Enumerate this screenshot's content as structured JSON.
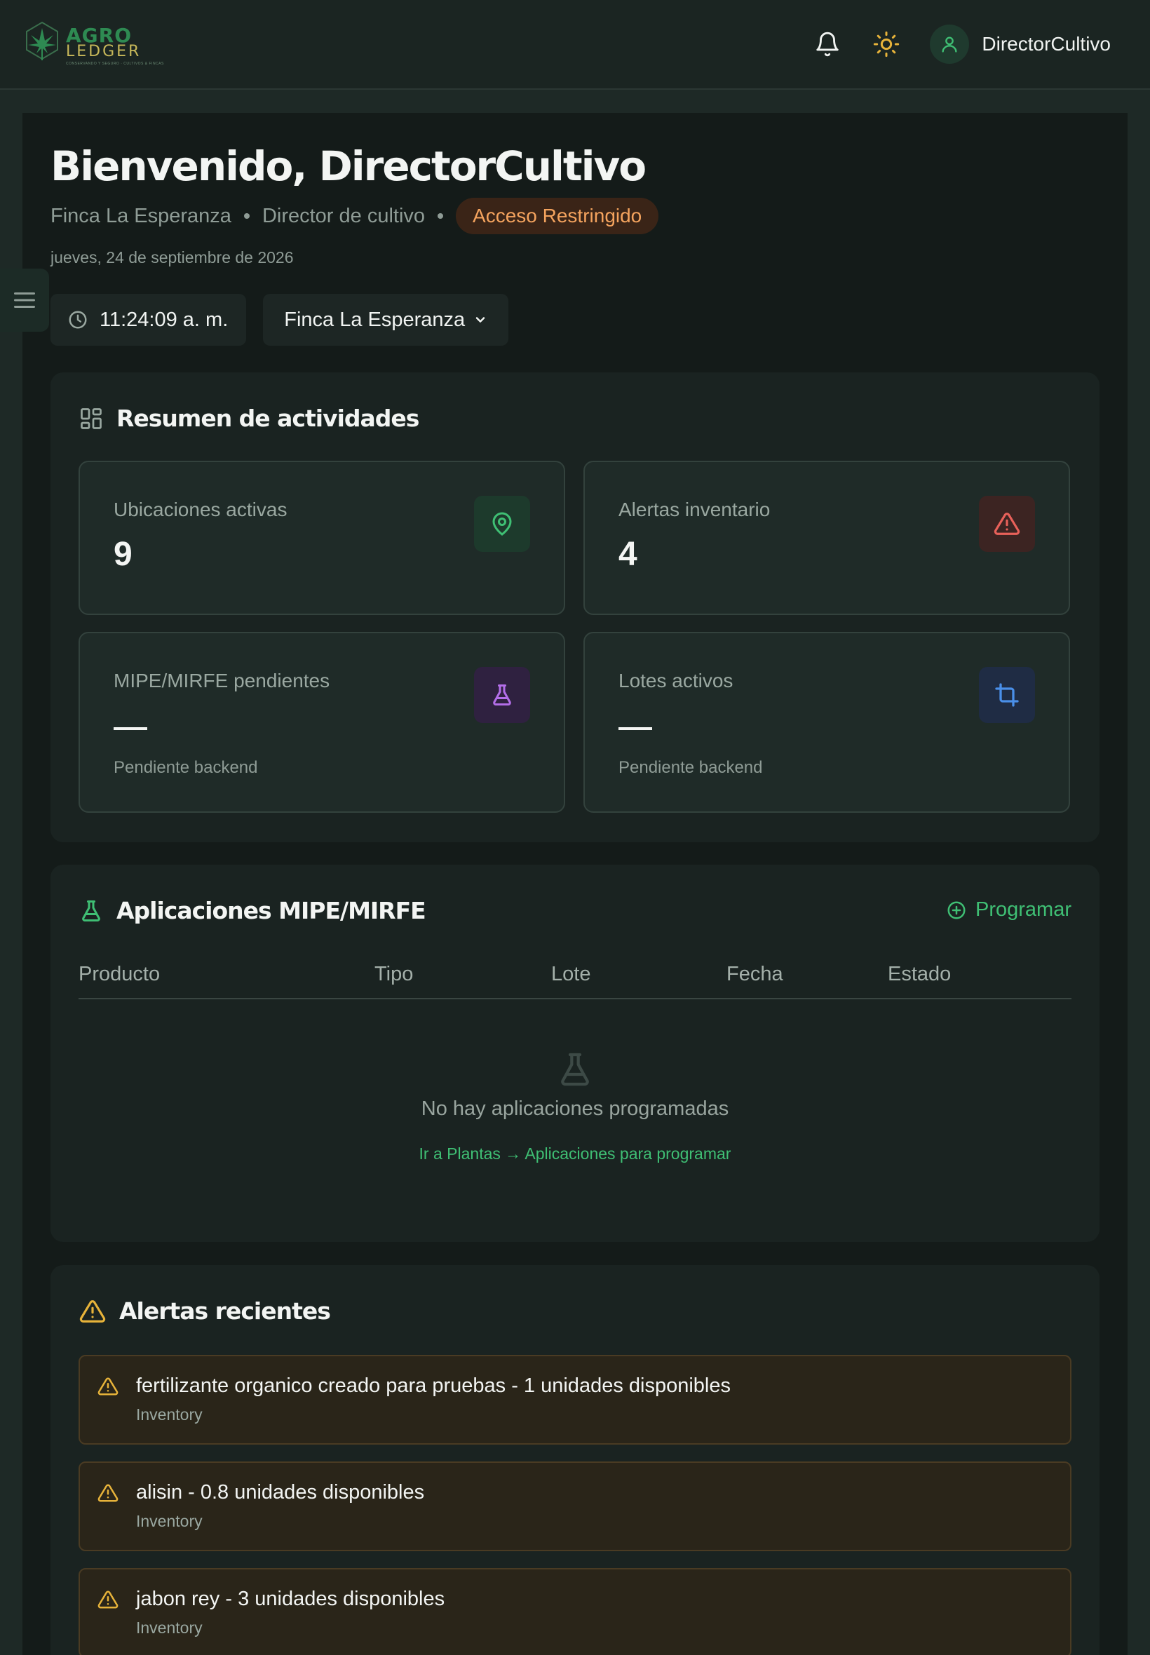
{
  "header": {
    "logo": {
      "primary": "AGRO",
      "secondary": "LEDGER",
      "tagline": "CONSERVANDO Y SEGURO · CULTIVOS & FINCAS"
    },
    "notifications_icon": "bell-icon",
    "theme_icon": "sun-icon",
    "user": {
      "name": "DirectorCultivo",
      "icon": "user-icon"
    }
  },
  "welcome": {
    "title": "Bienvenido, DirectorCultivo",
    "farm": "Finca La Esperanza",
    "role": "Director de cultivo",
    "access_badge": "Acceso Restringido",
    "date": "jueves, 24 de septiembre de 2026"
  },
  "controls": {
    "time": "11:24:09 a. m.",
    "farm_selected": "Finca La Esperanza"
  },
  "summary": {
    "title": "Resumen de actividades",
    "stats": [
      {
        "label": "Ubicaciones activas",
        "value": "9",
        "icon": "map-pin-icon",
        "color": "#3fbf74"
      },
      {
        "label": "Alertas inventario",
        "value": "4",
        "icon": "alert-triangle-icon",
        "color": "#e8615a"
      },
      {
        "label": "MIPE/MIRFE pendientes",
        "value": "—",
        "note": "Pendiente backend",
        "icon": "flask-icon",
        "color": "#b36ee8"
      },
      {
        "label": "Lotes activos",
        "value": "—",
        "note": "Pendiente backend",
        "icon": "crop-icon",
        "color": "#4a8fe8"
      }
    ]
  },
  "applications": {
    "title": "Aplicaciones MIPE/MIRFE",
    "action": "Programar",
    "columns": [
      "Producto",
      "Tipo",
      "Lote",
      "Fecha",
      "Estado"
    ],
    "empty_title": "No hay aplicaciones programadas",
    "empty_link": "Ir a Plantas → Aplicaciones para programar"
  },
  "alerts": {
    "title": "Alertas recientes",
    "items": [
      {
        "message": "fertilizante organico creado para pruebas - 1 unidades disponibles",
        "source": "Inventory"
      },
      {
        "message": "alisin - 0.8 unidades disponibles",
        "source": "Inventory"
      },
      {
        "message": "jabon rey - 3 unidades disponibles",
        "source": "Inventory"
      }
    ]
  },
  "colors": {
    "accent": "#3fbf74",
    "warning": "#e7b33a",
    "badge": "#f4a35e"
  }
}
